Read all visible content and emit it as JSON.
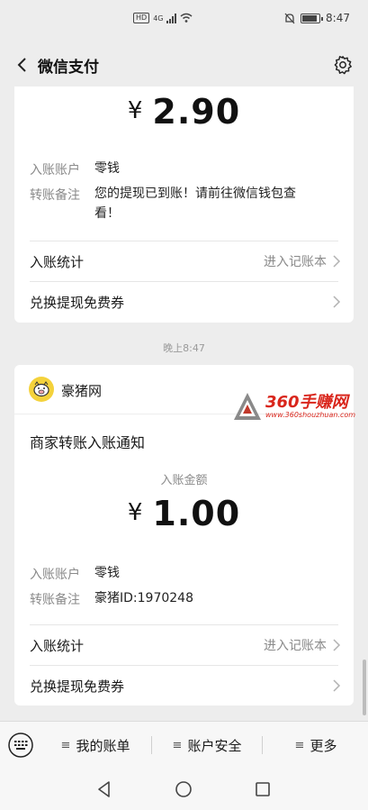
{
  "status_bar": {
    "hd": "HD",
    "network": "4G",
    "time": "8:47"
  },
  "nav": {
    "title": "微信支付",
    "back_icon": "chevron-left-icon",
    "settings_icon": "gear-icon"
  },
  "card1": {
    "currency": "¥",
    "amount": "2.90",
    "account_label": "入账账户",
    "account_value": "零钱",
    "note_label": "转账备注",
    "note_value_line1": "您的提现已到账！请前往微信钱包查",
    "note_value_line2": "看！",
    "stats_label": "入账统计",
    "stats_hint": "进入记账本",
    "voucher_label": "兑换提现免费券"
  },
  "timestamp": "晚上8:47",
  "card2": {
    "merchant_name": "豪猪网",
    "notice_title": "商家转账入账通知",
    "amount_caption": "入账金额",
    "currency": "¥",
    "amount": "1.00",
    "account_label": "入账账户",
    "account_value": "零钱",
    "note_label": "转账备注",
    "note_value": "豪猪ID:1970248",
    "stats_label": "入账统计",
    "stats_hint": "进入记账本",
    "voucher_label": "兑换提现免费券"
  },
  "watermark": {
    "text": "360手赚网",
    "url": "www.360shouzhuan.com"
  },
  "bottom_menu": {
    "items": [
      {
        "prefix": "≡",
        "label": "我的账单"
      },
      {
        "prefix": "≡",
        "label": "账户安全"
      },
      {
        "prefix": "≡",
        "label": "更多"
      }
    ]
  },
  "colors": {
    "background": "#ededed",
    "card": "#ffffff",
    "watermark": "#d9261c",
    "merchant_logo": "#f4d23c"
  }
}
